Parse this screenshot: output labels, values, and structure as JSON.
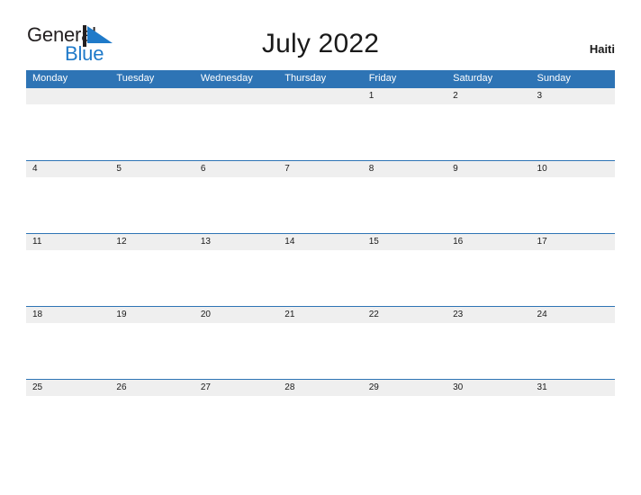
{
  "header": {
    "logo": {
      "text_primary": "General",
      "text_secondary": "Blue",
      "flag_icon": "blue-triangle-flag-icon",
      "color_primary": "#231f20",
      "color_secondary": "#1f7ac9"
    },
    "title": "July 2022",
    "subtitle": "Haiti"
  },
  "calendar": {
    "accent_color": "#2e74b5",
    "band_color": "#efefef",
    "day_names": [
      "Monday",
      "Tuesday",
      "Wednesday",
      "Thursday",
      "Friday",
      "Saturday",
      "Sunday"
    ],
    "weeks": [
      {
        "days": [
          "",
          "",
          "",
          "",
          "1",
          "2",
          "3"
        ]
      },
      {
        "days": [
          "4",
          "5",
          "6",
          "7",
          "8",
          "9",
          "10"
        ]
      },
      {
        "days": [
          "11",
          "12",
          "13",
          "14",
          "15",
          "16",
          "17"
        ]
      },
      {
        "days": [
          "18",
          "19",
          "20",
          "21",
          "22",
          "23",
          "24"
        ]
      },
      {
        "days": [
          "25",
          "26",
          "27",
          "28",
          "29",
          "30",
          "31"
        ]
      }
    ]
  }
}
